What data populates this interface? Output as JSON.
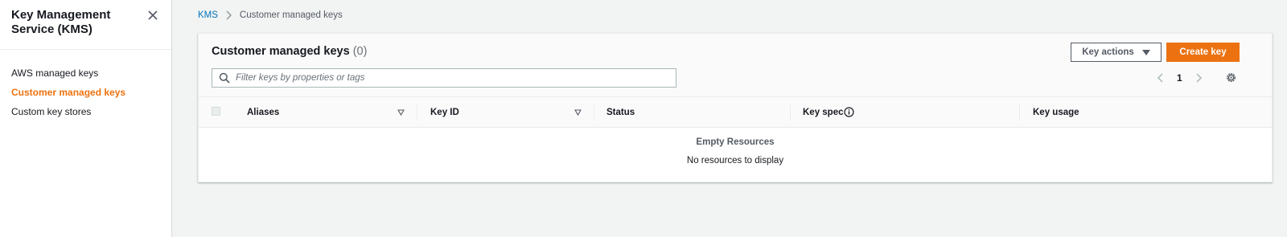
{
  "sidebar": {
    "title": "Key Management Service (KMS)",
    "items": [
      {
        "label": "AWS managed keys"
      },
      {
        "label": "Customer managed keys"
      },
      {
        "label": "Custom key stores"
      }
    ]
  },
  "breadcrumb": {
    "root": "KMS",
    "current": "Customer managed keys"
  },
  "panel": {
    "title": "Customer managed keys",
    "count": "(0)",
    "actions_label": "Key actions",
    "create_label": "Create key",
    "search_placeholder": "Filter keys by properties or tags",
    "search_value": "",
    "page": "1"
  },
  "table": {
    "columns": [
      "Aliases",
      "Key ID",
      "Status",
      "Key spec",
      "Key usage"
    ],
    "empty_title": "Empty Resources",
    "empty_message": "No resources to display"
  },
  "colors": {
    "accent": "#ec7211",
    "link": "#0073bb",
    "background": "#f2f3f3"
  },
  "icons": {
    "close": "close-icon",
    "breadcrumb_separator": "chevron-right-icon",
    "search": "search-icon",
    "actions_caret": "caret-down-icon",
    "prev": "chevron-left-icon",
    "next": "chevron-right-icon",
    "settings": "gear-icon",
    "sort": "sort-down-icon",
    "info": "info-icon"
  }
}
